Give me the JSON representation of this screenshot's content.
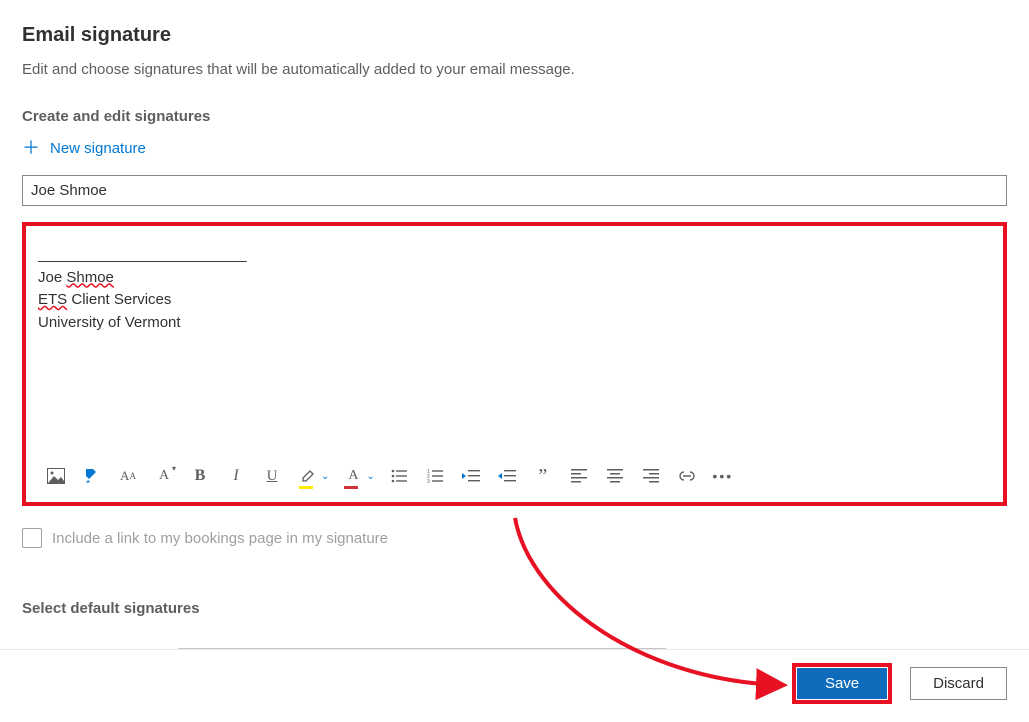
{
  "header": {
    "title": "Email signature",
    "description": "Edit and choose signatures that will be automatically added to your email message."
  },
  "section": {
    "create_label": "Create and edit signatures",
    "new_signature_label": "New signature",
    "selected_signature_name": "Joe Shmoe"
  },
  "editor": {
    "separator_line": "_________________________",
    "line1_a": "Joe ",
    "line1_b": "Shmoe",
    "line2_a": "ETS",
    "line2_b": " Client Services",
    "line3": "University of Vermont"
  },
  "toolbar": {
    "icons": [
      "image-icon",
      "format-painter-icon",
      "font-icon",
      "font-size-icon",
      "bold-icon",
      "italic-icon",
      "underline-icon",
      "highlight-icon",
      "font-color-icon",
      "bullet-list-icon",
      "number-list-icon",
      "outdent-icon",
      "indent-icon",
      "quote-icon",
      "align-left-icon",
      "align-center-icon",
      "align-right-icon",
      "link-icon",
      "more-icon"
    ]
  },
  "checkbox": {
    "label": "Include a link to my bookings page in my signature"
  },
  "defaults": {
    "label": "Select default signatures"
  },
  "footer": {
    "save_label": "Save",
    "discard_label": "Discard"
  },
  "annotation": {
    "highlight_color": "#e81123",
    "arrow_color": "#e81123"
  }
}
